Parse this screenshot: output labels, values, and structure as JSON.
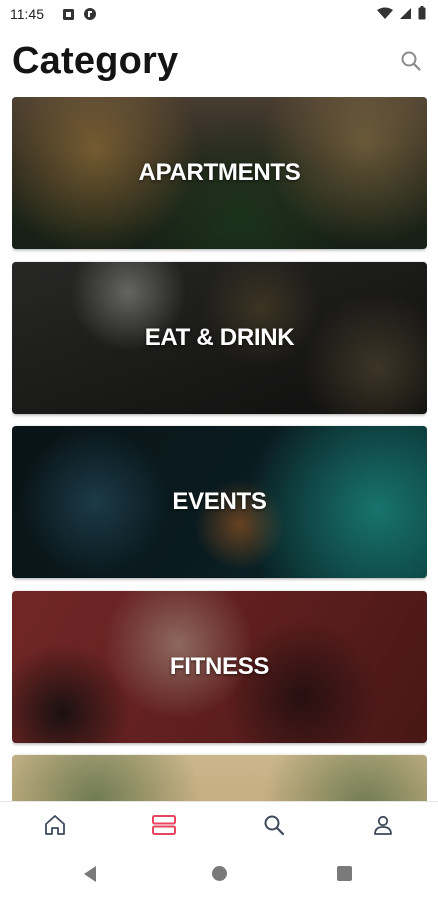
{
  "status_bar": {
    "time": "11:45",
    "left_icons": [
      "notification-box-icon",
      "app-circle-icon"
    ],
    "right_icons": [
      "wifi-icon",
      "cellular-signal-icon",
      "battery-icon"
    ]
  },
  "header": {
    "title": "Category",
    "search_icon": "search-icon"
  },
  "categories": [
    {
      "label": "APARTMENTS"
    },
    {
      "label": "EAT & DRINK"
    },
    {
      "label": "EVENTS"
    },
    {
      "label": "FITNESS"
    },
    {
      "label": ""
    }
  ],
  "bottom_nav": {
    "items": [
      {
        "icon": "home-icon",
        "active": false
      },
      {
        "icon": "category-list-icon",
        "active": true
      },
      {
        "icon": "search-icon",
        "active": false
      },
      {
        "icon": "profile-icon",
        "active": false
      }
    ],
    "active_color": "#e8455f",
    "inactive_color": "#3d4a5c"
  },
  "system_nav": {
    "buttons": [
      "back-icon",
      "home-circle-icon",
      "recents-square-icon"
    ]
  }
}
